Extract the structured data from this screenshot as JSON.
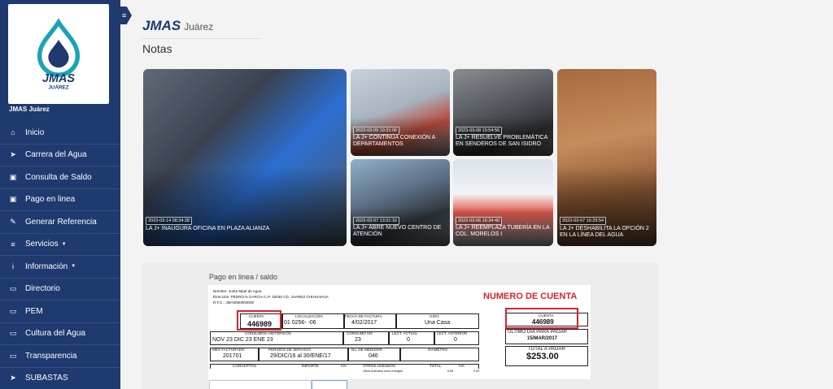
{
  "sidebar": {
    "brand": "JMAS Juárez",
    "logo_text": "JMAS",
    "logo_subtext": "JUÁREZ",
    "items": [
      {
        "label": "Inicio",
        "icon": "home-icon"
      },
      {
        "label": "Carrera del Agua",
        "icon": "send-icon"
      },
      {
        "label": "Consulta de Saldo",
        "icon": "money-icon"
      },
      {
        "label": "Pago en linea",
        "icon": "money-icon"
      },
      {
        "label": "Generar Referencia",
        "icon": "edit-icon"
      },
      {
        "label": "Servicios",
        "icon": "list-icon",
        "dropdown": true
      },
      {
        "label": "Información",
        "icon": "info-icon",
        "dropdown": true
      },
      {
        "label": "Directorio",
        "icon": "card-icon"
      },
      {
        "label": "PEM",
        "icon": "card-icon"
      },
      {
        "label": "Cultura del Agua",
        "icon": "card-icon"
      },
      {
        "label": "Transparencia",
        "icon": "card-icon"
      },
      {
        "label": "SUBASTAS",
        "icon": "send-icon"
      }
    ],
    "colors": {
      "bg": "#1e3a6e",
      "logo_teal": "#1aa3b5"
    }
  },
  "header": {
    "title": "JMAS",
    "subtitle": "Juárez"
  },
  "section": {
    "title": "Notas"
  },
  "news": [
    {
      "date": "2023-03-14 08:34:28",
      "title": "LA J+ INAUGURA OFICINA EN PLAZA ALIANZA"
    },
    {
      "date": "2023-03-09 10:31:06",
      "title": "LA J+ CONTINÚA CONEXIÓN A DEPARTAMENTOS"
    },
    {
      "date": "2023-03-08 15:54:56",
      "title": "LA J+ RESUELVE PROBLEMÁTICA EN SENDEROS DE SAN ISIDRO"
    },
    {
      "date": "2023-03-07 16:29:54",
      "title": "LA J+ DESHABILITA LA OPCIÓN 2 EN LA LÍNEA DEL AGUA"
    },
    {
      "date": "2023-03-07 13:31:16",
      "title": "LA J+ ABRE NUEVO CENTRO DE ATENCIÓN"
    },
    {
      "date": "2023-03-06 16:34:40",
      "title": "LA J+ REEMPLAZA TUBERÍA EN LA COL. MORELOS I"
    }
  ],
  "payment": {
    "title": "Pago en linea / saldo",
    "bill": {
      "nombre": "Nombre: Junta Mpal de Agua",
      "direccion": "Dirección: PEDRO N GARCIA C.P. 32030  CD. JUAREZ CHIHUAHUA",
      "rfc": "R.F.C.:  JMA0000000000",
      "numero_label": "NUMERO DE CUENTA",
      "cuenta_label": "CUENTA",
      "cuenta_value": "446989",
      "localizacion_label": "LOCALIZACION",
      "localizacion_value": "01   0256-   -06",
      "fecha_factura_label": "FECHA DE FACTURA",
      "fecha_factura_value": "4/02/2017",
      "giro_label": "GIRO",
      "giro_value": "Una Casa",
      "consumos_label": "CONSUMOS HISTORICOS",
      "consumos_value": "NOV 23   DIC   23    ENE  23",
      "consumo_m3_label": "CONSUMO M3",
      "consumo_m3_value": "23",
      "lect_actual_label": "LECT. ACTUAL",
      "lect_actual_value": "0",
      "lect_anterior_label": "LECT. ANTERIOR",
      "lect_anterior_value": "0",
      "mes_facturado_label": "MES FACTURADO",
      "mes_facturado_value": "201701",
      "periodo_label": "PERIODO DE SERVICIO",
      "periodo_value": "29/DIC/16 al 30/ENE/17",
      "medidor_label": "No. DE MEDIDOR",
      "medidor_value": "046",
      "diametro_label": "DIAMETRO",
      "conceptos_label": "CONCEPTOS",
      "importe_label": "IMPORTE",
      "iva_label": "IVA",
      "otros_label": "OTROS ADEUDOS",
      "total_label": "TOTAL",
      "iva2_label": "IVA",
      "otros_row": "Otros Adeudos mas recargos",
      "otros_total": "0.84",
      "otros_iva": "0.00",
      "right_cuenta_label": "CUENTA",
      "right_cuenta_value": "446989",
      "ultimo_dia_label": "ULTIMO DIA PARA PAGAR",
      "ultimo_dia_value": "15/MAR/2017",
      "total_pagar_label": "TOTAL A PAGAR",
      "total_pagar_value": "$253.00"
    }
  }
}
